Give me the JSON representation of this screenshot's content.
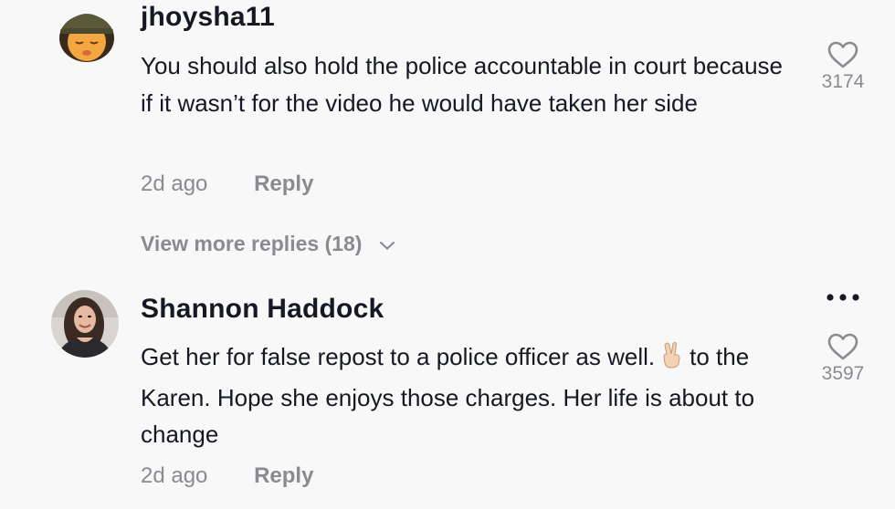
{
  "comments": [
    {
      "username": "jhoysha11",
      "text_parts": [
        "You should also hold the police accountable in court because if it wasn’t for the video he would have taken her side"
      ],
      "time": "2d ago",
      "reply_label": "Reply",
      "likes": "3174",
      "avatar_icon": "bitmoji-avatar-icon"
    },
    {
      "username": "Shannon Haddock",
      "text_before_emoji": "Get her for false repost to a police officer as well.",
      "emoji": "✌🏻",
      "text_after_emoji": "to the Karen. Hope she enjoys those charges. Her life is about to change",
      "time": "2d ago",
      "reply_label": "Reply",
      "likes": "3597",
      "avatar_icon": "profile-photo-avatar-icon"
    }
  ],
  "view_more_replies": "View more replies (18)",
  "colors": {
    "background": "#f8f8f8",
    "primary_text": "#161823",
    "secondary_text": "#8a8b91"
  }
}
